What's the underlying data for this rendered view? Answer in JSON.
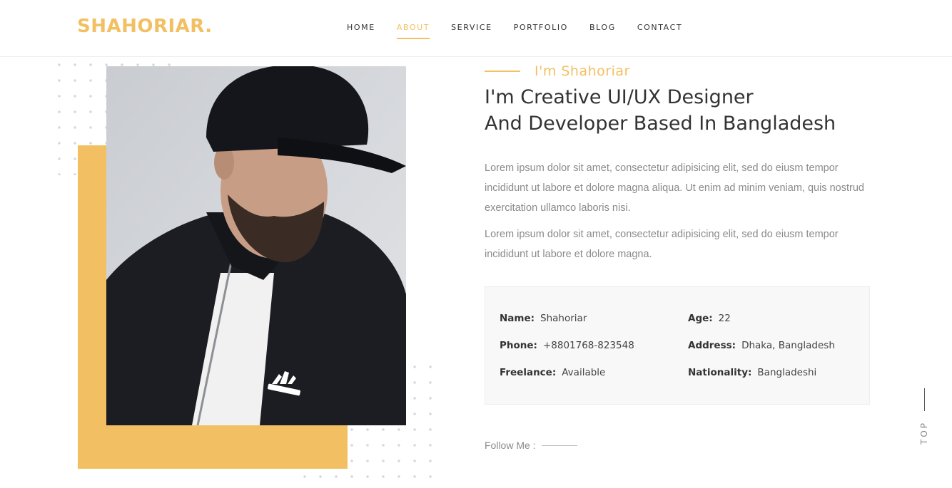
{
  "header": {
    "logo_text": "SHAHORIAR",
    "logo_dot": ".",
    "nav": [
      {
        "label": "HOME",
        "active": false
      },
      {
        "label": "ABOUT",
        "active": true
      },
      {
        "label": "SERVICE",
        "active": false
      },
      {
        "label": "PORTFOLIO",
        "active": false
      },
      {
        "label": "BLOG",
        "active": false
      },
      {
        "label": "CONTACT",
        "active": false
      }
    ]
  },
  "about": {
    "subtitle": "I'm Shahoriar",
    "heading_line1": "I'm Creative UI/UX Designer",
    "heading_line2": "And Developer Based In Bangladesh",
    "paragraph1": "Lorem ipsum dolor sit amet, consectetur adipisicing elit, sed do eiusm tempor incididunt ut labore et dolore magna aliqua. Ut enim ad minim veniam, quis nostrud exercitation ullamco laboris nisi.",
    "paragraph2": "Lorem ipsum dolor sit amet, consectetur adipisicing elit, sed do eiusm tempor incididunt ut labore et dolore magna.",
    "info": {
      "name_label": "Name:",
      "name_value": "Shahoriar",
      "age_label": "Age:",
      "age_value": "22",
      "phone_label": "Phone:",
      "phone_value": "+8801768-823548",
      "address_label": "Address:",
      "address_value": "Dhaka, Bangladesh",
      "freelance_label": "Freelance:",
      "freelance_value": "Available",
      "nationality_label": "Nationality:",
      "nationality_value": "Bangladeshi"
    },
    "follow_label": "Follow Me :"
  },
  "scroll_top_label": "TOP",
  "colors": {
    "accent": "#f2c062",
    "text_dark": "#333333",
    "text_muted": "#8a8a8a"
  }
}
